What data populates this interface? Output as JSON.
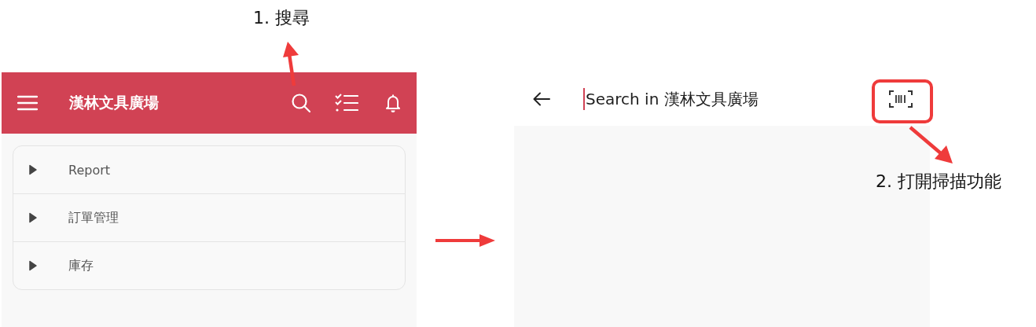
{
  "annotations": [
    {
      "text": "1. 搜尋"
    },
    {
      "text": "2. 打開掃描功能"
    }
  ],
  "home_screen": {
    "app_bar": {
      "title": "漢林文具廣場"
    },
    "menu": [
      {
        "label": "Report",
        "expanded": false
      },
      {
        "label": "訂單管理",
        "expanded": false
      },
      {
        "label": "庫存",
        "expanded": false
      }
    ]
  },
  "search_screen": {
    "search": {
      "placeholder": "Search in 漢林文具廣場"
    }
  }
}
